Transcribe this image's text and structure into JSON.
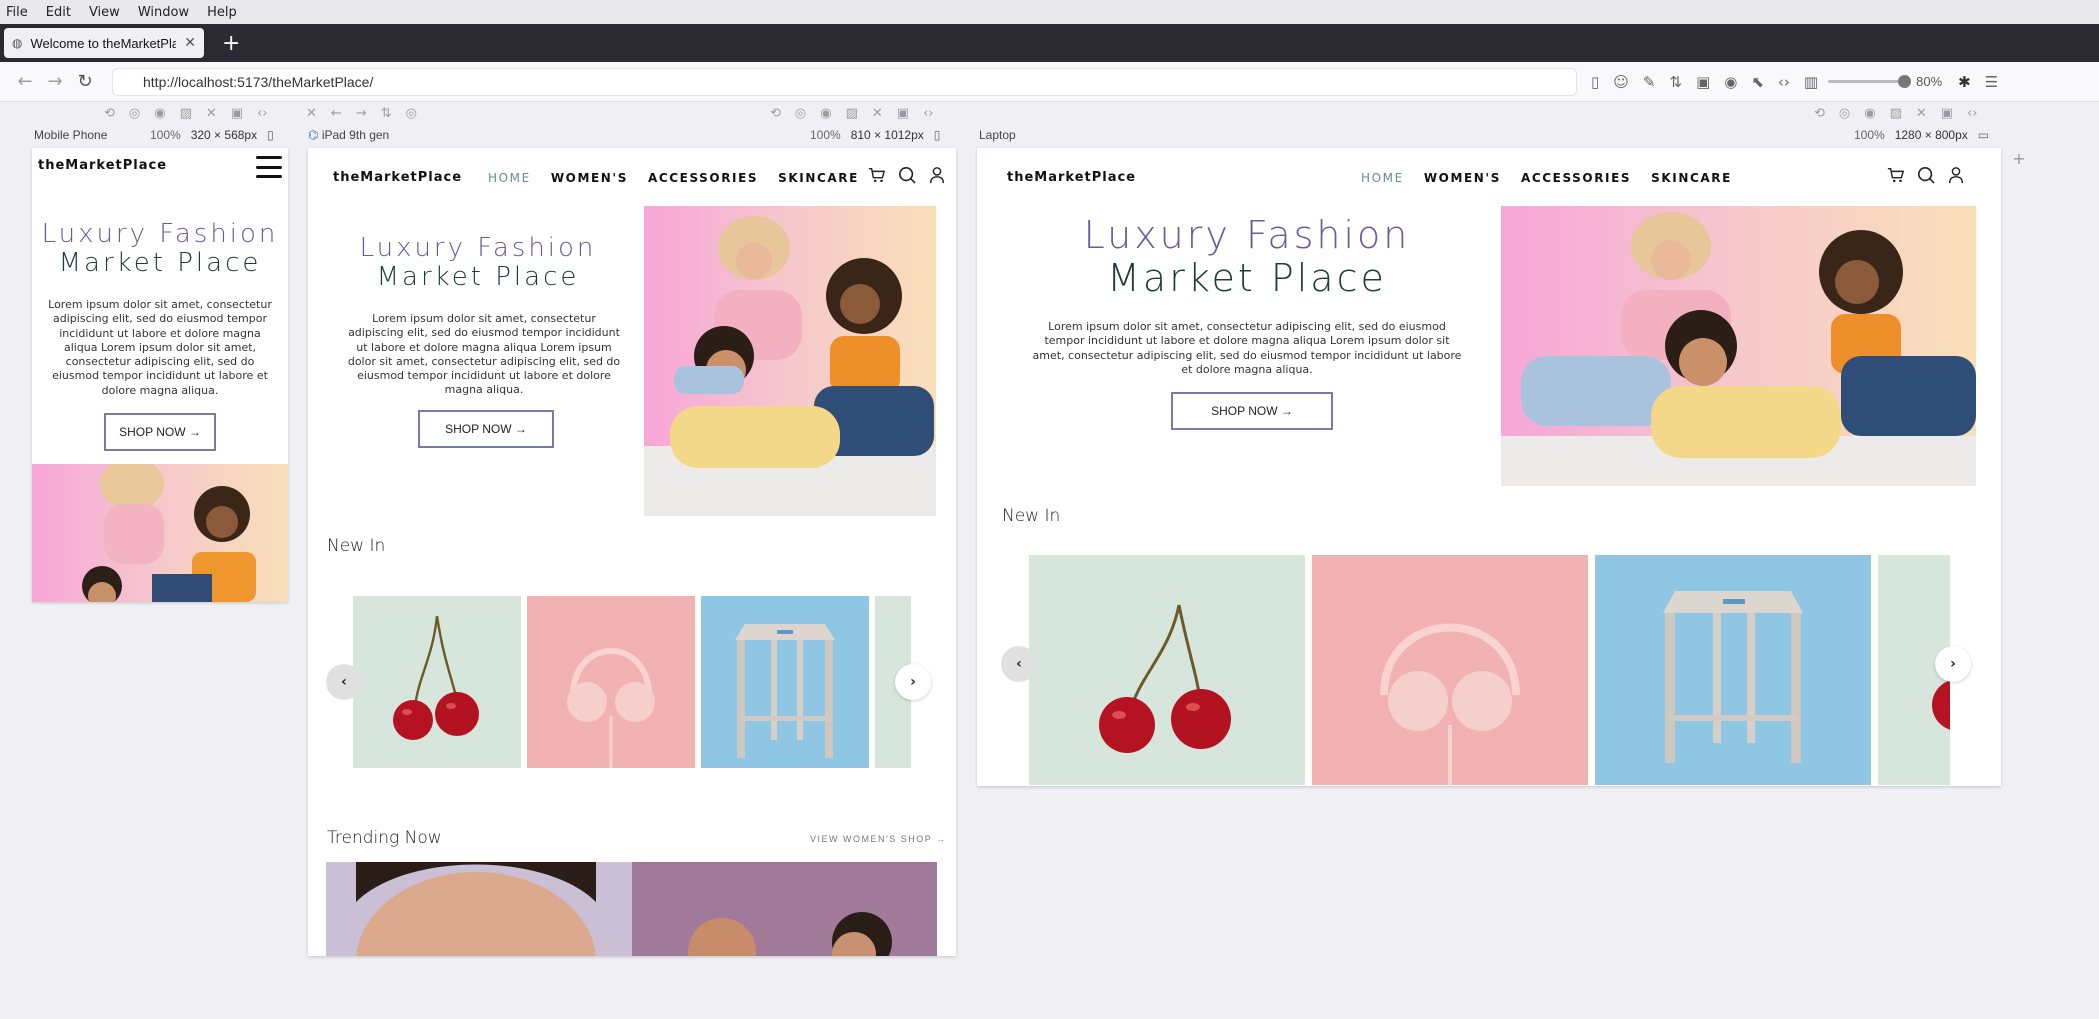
{
  "menubar": [
    "File",
    "Edit",
    "View",
    "Window",
    "Help"
  ],
  "browser": {
    "tab_title": "Welcome to theMarketPlace",
    "tab_close": "✕",
    "new_tab": "+",
    "url": "http://localhost:5173/theMarketPlace/",
    "zoom": "80%",
    "zoom_level": 0.8
  },
  "devices": {
    "mobile": {
      "label": "Mobile Phone",
      "zoom": "100%",
      "size": "320 × 568px"
    },
    "ipad": {
      "label": "iPad 9th gen",
      "zoom": "100%",
      "size": "810 × 1012px"
    },
    "laptop": {
      "label": "Laptop",
      "zoom": "100%",
      "size": "1280 × 800px"
    }
  },
  "site": {
    "logo": "theMarketPlace",
    "nav": [
      "HOME",
      "WOMEN'S",
      "ACCESSORIES",
      "SKINCARE"
    ],
    "hero_line1": "Luxury Fashion",
    "hero_line2": "Market Place",
    "hero_text_short": "Lorem ipsum dolor sit amet, consectetur adipiscing elit, sed do eiusmod tempor incididunt ut labore et dolore magna aliqua Lorem ipsum dolor sit amet, consectetur adipiscing elit, sed do eiusmod tempor incididunt ut labore et dolore magna aliqua.",
    "shop_now": "SHOP NOW →",
    "new_in": "New In",
    "trending": "Trending Now",
    "view_womens": "VIEW WOMEN'S SHOP →",
    "prev": "‹",
    "next": "›"
  },
  "colors": {
    "accent_purple": "#6a5a9a",
    "accent_teal": "#1e3a3a",
    "nav_active": "#6b8f8a",
    "tile_mint": "#d6e6dc",
    "tile_pink": "#f2b1b2",
    "tile_blue": "#8fc6e3"
  }
}
